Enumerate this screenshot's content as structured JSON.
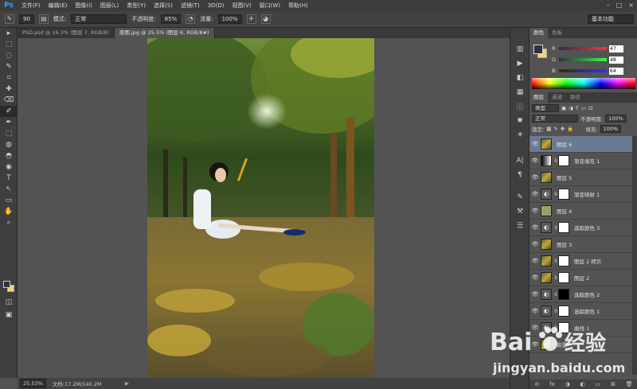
{
  "menubar": {
    "logo": "Ps",
    "items": [
      "文件(F)",
      "编辑(E)",
      "图像(I)",
      "图层(L)",
      "类型(Y)",
      "选择(S)",
      "滤镜(T)",
      "3D(D)",
      "视图(V)",
      "窗口(W)",
      "帮助(H)"
    ],
    "window_buttons": [
      "–",
      "□",
      "×"
    ]
  },
  "options": {
    "brush_size": "90",
    "mode_label": "模式:",
    "mode_value": "正常",
    "opacity_label": "不透明度:",
    "opacity_value": "85%",
    "flow_label": "流量:",
    "flow_value": "100%",
    "workspace": "基本功能"
  },
  "tabs": [
    {
      "label": "PSD.psd @ 16.3% (图层 7, RGB/8)",
      "active": false
    },
    {
      "label": "原图.jpg @ 25.5% (图层 6, RGB/8#)",
      "active": true
    }
  ],
  "tools": [
    "▸",
    "⬚",
    "◌",
    "✎",
    "⌗",
    "✚",
    "⌫",
    "✐",
    "✒",
    "⬚",
    "◍",
    "◓",
    "◉",
    "T",
    "↖",
    "▭",
    "✋",
    "⌕"
  ],
  "status": {
    "zoom": "25.53%",
    "doc": "文档:17.2M/140.2M"
  },
  "color_panel": {
    "tabs": [
      "颜色",
      "色板"
    ],
    "channels": [
      {
        "ch": "R",
        "value": "47",
        "color": "#d23b3b"
      },
      {
        "ch": "G",
        "value": "48",
        "color": "#3bbf3b"
      },
      {
        "ch": "B",
        "value": "64",
        "color": "#3b55d2"
      }
    ],
    "fg": "#2f3040",
    "bg": "#f5d27a"
  },
  "layers_panel": {
    "tabs": [
      "图层",
      "通道",
      "路径"
    ],
    "filter": "类型",
    "blend": "正常",
    "opacity_label": "不透明度:",
    "opacity": "100%",
    "lock_label": "锁定:",
    "fill_label": "填充:",
    "fill": "100%",
    "layers": [
      {
        "name": "图层 6",
        "thumb": "photo-t",
        "mask": "",
        "selected": true
      },
      {
        "name": "渐变填充 1",
        "thumb": "grad",
        "mask": "white",
        "selected": false
      },
      {
        "name": "图层 5",
        "thumb": "photo-t",
        "mask": "",
        "selected": false
      },
      {
        "name": "渐变映射 1",
        "thumb": "adj",
        "mask": "white",
        "selected": false
      },
      {
        "name": "图层 4",
        "thumb": "olive",
        "mask": "",
        "selected": false
      },
      {
        "name": "选取颜色 3",
        "thumb": "adj",
        "mask": "white",
        "selected": false
      },
      {
        "name": "图层 3",
        "thumb": "photo-t",
        "mask": "",
        "selected": false
      },
      {
        "name": "图层 2 拷贝",
        "thumb": "photo-t",
        "mask": "white",
        "selected": false
      },
      {
        "name": "图层 2",
        "thumb": "photo-t",
        "mask": "white",
        "selected": false
      },
      {
        "name": "选取颜色 2",
        "thumb": "adj",
        "mask": "black",
        "selected": false
      },
      {
        "name": "选取颜色 1",
        "thumb": "adj",
        "mask": "white",
        "selected": false
      },
      {
        "name": "曲线 1",
        "thumb": "adj",
        "mask": "white",
        "selected": false
      },
      {
        "name": "背景",
        "thumb": "photo-t",
        "mask": "",
        "selected": false
      }
    ],
    "bottom_icons": [
      "⊝",
      "fx",
      "◑",
      "◐",
      "▭",
      "⊞",
      "🗑"
    ]
  },
  "watermark": {
    "brand": "Bai",
    "brand2": "经验",
    "url": "jingyan.baidu.com"
  }
}
